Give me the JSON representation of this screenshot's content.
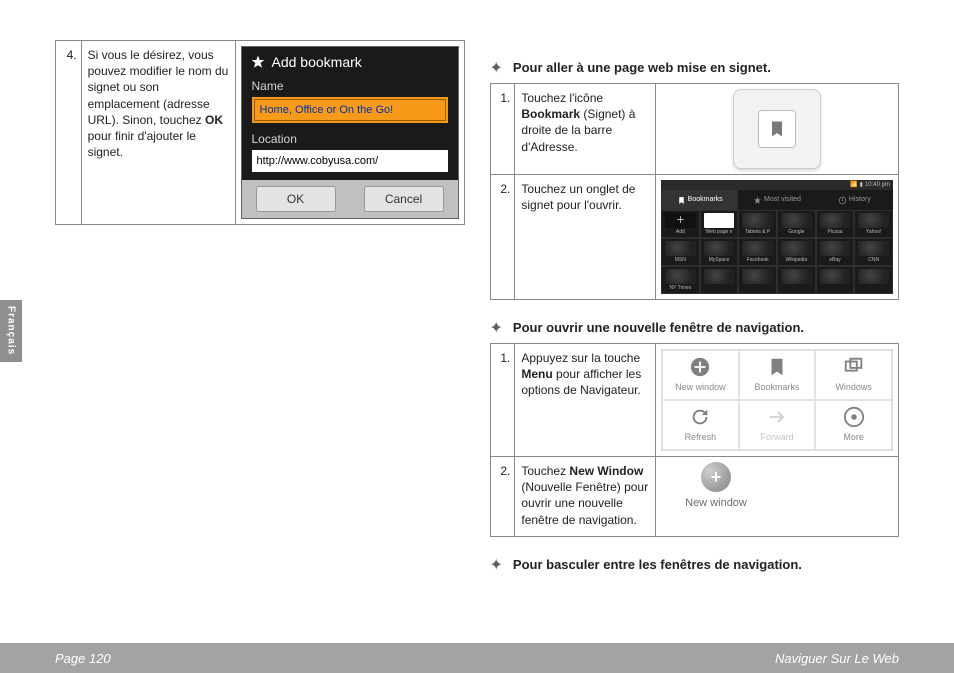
{
  "left": {
    "row4": {
      "num": "4.",
      "text_before": "Si vous le désirez, vous pouvez modifier le nom du signet ou son emplacement (adresse URL). Sinon, touchez ",
      "bold": "OK",
      "text_after": " pour finir d'ajouter le signet."
    },
    "dialog": {
      "title": "Add bookmark",
      "name_label": "Name",
      "name_value": "Home, Office or On the Go!",
      "location_label": "Location",
      "location_value": "http://www.cobyusa.com/",
      "ok": "OK",
      "cancel": "Cancel"
    }
  },
  "right": {
    "h1": "Pour aller à une page web mise en signet.",
    "t1": {
      "r1": {
        "num": "1.",
        "a": "Touchez l'icône ",
        "b": "Bookmark",
        "c": " (Signet) à droite de la barre d'Adresse."
      },
      "r2": {
        "num": "2.",
        "a": "Touchez un onglet de signet pour l'ouvrir."
      }
    },
    "browser": {
      "time": "10:40 pm",
      "tabs": {
        "bookmarks": "Bookmarks",
        "most": "Most visited",
        "history": "History"
      },
      "cells": [
        "Add",
        "Web page n",
        "Tablets & P",
        "Google",
        "Picasa",
        "Yahoo!",
        "MSN",
        "MySpace",
        "Facebook",
        "Wikipedia",
        "eBay",
        "CNN",
        "NY Times"
      ]
    },
    "h2": "Pour ouvrir une nouvelle fenêtre de navigation.",
    "t2": {
      "r1": {
        "num": "1.",
        "a": "Appuyez sur la touche ",
        "b": "Menu",
        "c": " pour afficher les options de Navigateur."
      },
      "r2": {
        "num": "2.",
        "a": "Touchez ",
        "b": "New Window",
        "c": " (Nouvelle Fenêtre) pour ouvrir une nouvelle fenêtre de navigation."
      }
    },
    "menu": {
      "newwindow": "New window",
      "bookmarks": "Bookmarks",
      "windows": "Windows",
      "refresh": "Refresh",
      "forward": "Forward",
      "more": "More"
    },
    "newwin_label": "New window",
    "h3": "Pour basculer entre les fenêtres de navigation."
  },
  "lang_tab": "Français",
  "footer": {
    "left": "Page 120",
    "right": "Naviguer Sur Le Web"
  }
}
